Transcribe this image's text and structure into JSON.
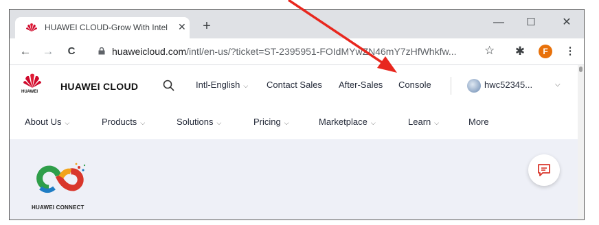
{
  "browser": {
    "tab_title": "HUAWEI CLOUD-Grow With Intel",
    "tab_close": "✕",
    "new_tab": "+",
    "minimize": "—",
    "maximize": "☐",
    "close": "✕",
    "back": "←",
    "forward": "→",
    "reload": "C",
    "url_host": "huaweicloud.com",
    "url_path": "/intl/en-us/?ticket=ST-2395951-FOIdMYwZN46mY7zHfWhkfw...",
    "bookmark": "☆",
    "extensions": "✱",
    "profile_initial": "F",
    "menu": "⋮"
  },
  "site": {
    "brand": "HUAWEI CLOUD",
    "logo_small_text": "HUAWEI",
    "header_links": {
      "language": "Intl-English",
      "contact_sales": "Contact Sales",
      "after_sales": "After-Sales",
      "console": "Console"
    },
    "user": "hwc52345...",
    "main_nav": [
      {
        "label": "About Us"
      },
      {
        "label": "Products"
      },
      {
        "label": "Solutions"
      },
      {
        "label": "Pricing"
      },
      {
        "label": "Marketplace"
      },
      {
        "label": "Learn"
      },
      {
        "label": "More"
      }
    ],
    "hero_logo_text": "HUAWEI CONNECT"
  },
  "annotation": {
    "arrow_color": "#e8271e"
  }
}
